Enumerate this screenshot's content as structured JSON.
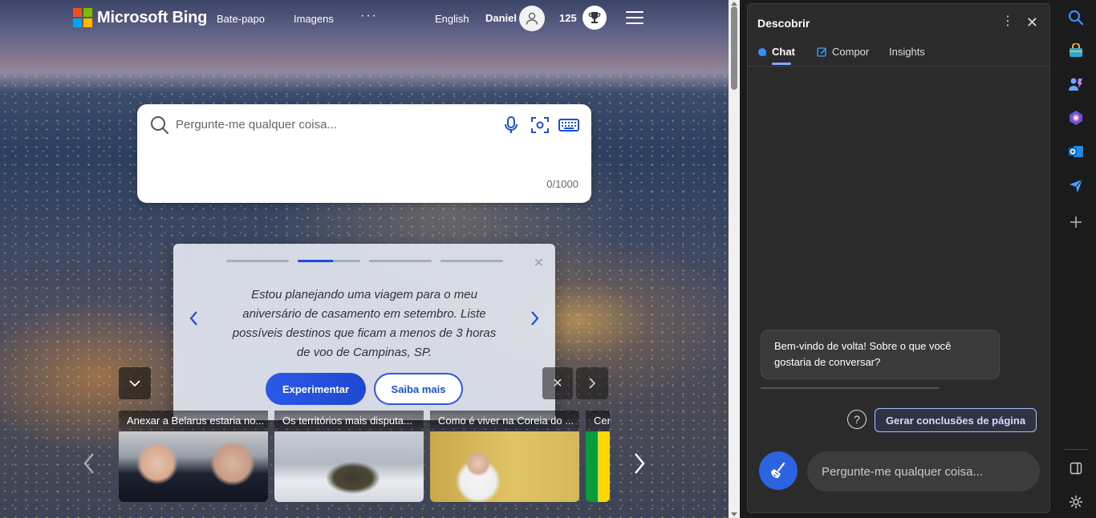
{
  "bing": {
    "logo_text": "Microsoft Bing",
    "nav": {
      "chat": "Bate-papo",
      "images": "Imagens",
      "more": "···"
    },
    "language": "English",
    "user_name": "Daniel",
    "points": "125",
    "search": {
      "placeholder": "Pergunte-me qualquer coisa...",
      "char_count": "0/1000"
    },
    "carousel": {
      "text": "Estou planejando uma viagem para o meu aniversário de casamento em setembro. Liste possíveis destinos que ficam a menos de 3 horas de voo de Campinas, SP.",
      "try_label": "Experimentar",
      "learn_label": "Saiba mais",
      "close": "✕"
    },
    "news": [
      {
        "title": "Anexar a Belarus estaria no..."
      },
      {
        "title": "Os territórios mais disputa..."
      },
      {
        "title": "Como é viver na Coreia do ..."
      },
      {
        "title": "Cer"
      }
    ]
  },
  "panel": {
    "title": "Descobrir",
    "tabs": {
      "chat": "Chat",
      "compose": "Compor",
      "insights": "Insights"
    },
    "welcome": "Bem-vindo de volta! Sobre o que você gostaria de conversar?",
    "help": "?",
    "generate_label": "Gerar conclusões de página",
    "input_placeholder": "Pergunte-me qualquer coisa..."
  },
  "colors": {
    "accent": "#2b63e0",
    "bing_blue": "#1b4fd6",
    "panel_bg": "#2b2b2b"
  },
  "icons": [
    "search-icon",
    "microphone-icon",
    "visual-search-icon",
    "keyboard-icon",
    "broom-icon",
    "gear-icon"
  ]
}
